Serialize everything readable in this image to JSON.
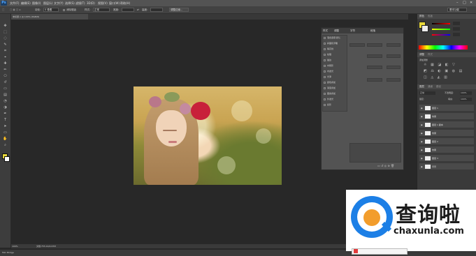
{
  "app": {
    "logo": "Ps"
  },
  "menu": [
    "文件(F)",
    "编辑(E)",
    "图像(I)",
    "图层(L)",
    "文字(Y)",
    "选择(S)",
    "滤镜(T)",
    "3D(D)",
    "视图(V)",
    "窗口(W)",
    "帮助(H)"
  ],
  "window_controls": {
    "minimize": "–",
    "maximize": "□",
    "close": "✕"
  },
  "options": {
    "feather_label": "羽化:",
    "feather_value": "0 像素",
    "antialias": "消除锯齿",
    "style_label": "样式:",
    "style_value": "正常",
    "width_label": "宽度:",
    "height_label": "高度:",
    "refine_edge": "调整边缘...",
    "workspace": "基本功能"
  },
  "document": {
    "tab_title": "未标题-1 @ 100% (RGB/8)"
  },
  "status": {
    "zoom": "100%",
    "doc_size": "文档:755.1K/4.67M"
  },
  "bottom": {
    "mini_bridge": "Mini Bridge"
  },
  "panel": {
    "tabs": [
      "样式",
      "调整",
      "字符",
      "段落"
    ],
    "items": [
      "混合选项:默认",
      "斜面和浮雕",
      "等高线",
      "纹理",
      "描边",
      "内阴影",
      "内发光",
      "光泽",
      "颜色叠加",
      "渐变叠加",
      "图案叠加",
      "外发光",
      "投影"
    ]
  },
  "color_panel": {
    "tabs": [
      "颜色",
      "色板"
    ]
  },
  "adjust_panel": {
    "tabs": [
      "调整",
      "样式"
    ],
    "title": "添加调整"
  },
  "layers_panel": {
    "tabs": [
      "图层",
      "通道",
      "路径"
    ],
    "blend_mode": "正常",
    "opacity_label": "不透明度:",
    "opacity": "100%",
    "lock_label": "锁定:",
    "fill_label": "填充:",
    "fill": "100%",
    "layers": [
      {
        "name": "图层 1"
      },
      {
        "name": "效果"
      },
      {
        "name": "图层 1 副本"
      },
      {
        "name": "效果"
      },
      {
        "name": "图层 2"
      },
      {
        "name": "效果"
      },
      {
        "name": "图层 3"
      },
      {
        "name": "背景"
      }
    ]
  },
  "watermark": {
    "title": "查询啦",
    "url": "chaxunla.com"
  },
  "colors": {
    "brand_blue": "#1c7fe6",
    "brand_orange": "#f29d2c"
  }
}
